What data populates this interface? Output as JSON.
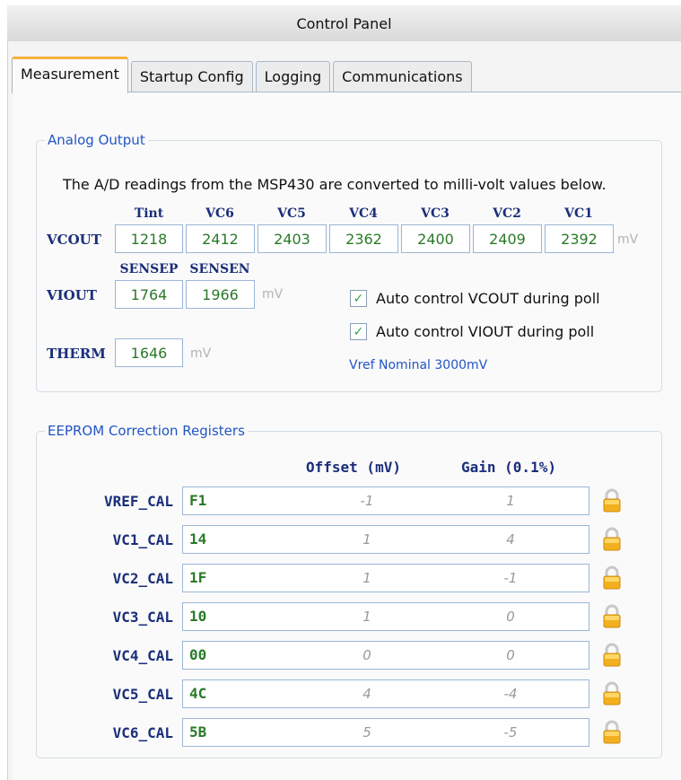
{
  "window": {
    "title": "Control Panel"
  },
  "tabs": [
    {
      "label": "Measurement",
      "active": true
    },
    {
      "label": "Startup Config",
      "active": false
    },
    {
      "label": "Logging",
      "active": false
    },
    {
      "label": "Communications",
      "active": false
    }
  ],
  "analog": {
    "legend": "Analog Output",
    "description": "The A/D readings from the MSP430 are converted to milli-volt values below.",
    "vcout": {
      "label": "VCOUT",
      "unit": "mV",
      "columns": [
        "Tint",
        "VC6",
        "VC5",
        "VC4",
        "VC3",
        "VC2",
        "VC1"
      ],
      "values": [
        "1218",
        "2412",
        "2403",
        "2362",
        "2400",
        "2409",
        "2392"
      ]
    },
    "viout": {
      "label": "VIOUT",
      "unit": "mV",
      "columns": [
        "SENSEP",
        "SENSEN"
      ],
      "values": [
        "1764",
        "1966"
      ]
    },
    "therm": {
      "label": "THERM",
      "value": "1646",
      "unit": "mV"
    },
    "auto_vcout": {
      "label": "Auto control VCOUT during poll",
      "checked": true
    },
    "auto_viout": {
      "label": "Auto control VIOUT during poll",
      "checked": true
    },
    "vref_nominal": "Vref Nominal 3000mV"
  },
  "eeprom": {
    "legend": "EEPROM Correction Registers",
    "offset_header": "Offset (mV)",
    "gain_header": "Gain (0.1%)",
    "registers": [
      {
        "label": "VREF_CAL",
        "hex": "F1",
        "offset": "-1",
        "gain": "1"
      },
      {
        "label": "VC1_CAL",
        "hex": "14",
        "offset": "1",
        "gain": "4"
      },
      {
        "label": "VC2_CAL",
        "hex": "1F",
        "offset": "1",
        "gain": "-1"
      },
      {
        "label": "VC3_CAL",
        "hex": "10",
        "offset": "1",
        "gain": "0"
      },
      {
        "label": "VC4_CAL",
        "hex": "00",
        "offset": "0",
        "gain": "0"
      },
      {
        "label": "VC5_CAL",
        "hex": "4C",
        "offset": "4",
        "gain": "-4"
      },
      {
        "label": "VC6_CAL",
        "hex": "5B",
        "offset": "5",
        "gain": "-5"
      }
    ],
    "lock_icon": "lock-icon"
  },
  "colors": {
    "accent": "#2355c4",
    "value_green": "#2a7a2a",
    "label_navy": "#1a2e7a",
    "tab_highlight": "#f6b23a",
    "lock_gold": "#f2b01e"
  }
}
